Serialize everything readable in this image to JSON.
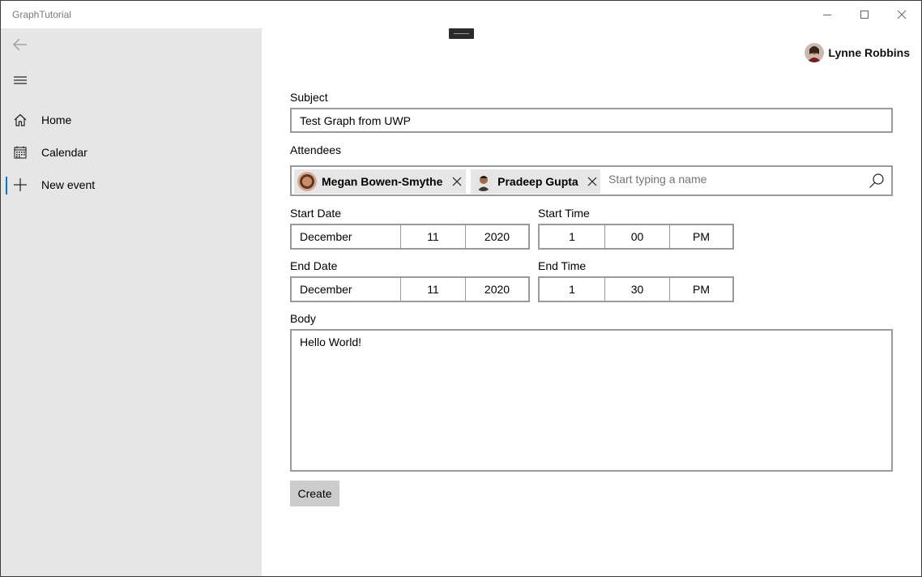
{
  "window": {
    "title": "GraphTutorial"
  },
  "sidebar": {
    "items": [
      {
        "label": "Home",
        "icon": "home-icon"
      },
      {
        "label": "Calendar",
        "icon": "calendar-icon"
      },
      {
        "label": "New event",
        "icon": "plus-icon",
        "selected": true
      }
    ]
  },
  "user": {
    "name": "Lynne Robbins"
  },
  "form": {
    "subject_label": "Subject",
    "subject_value": "Test Graph from UWP",
    "attendees_label": "Attendees",
    "attendees": [
      {
        "name": "Megan Bowen-Smythe"
      },
      {
        "name": "Pradeep Gupta"
      }
    ],
    "attendees_placeholder": "Start typing a name",
    "start_date_label": "Start Date",
    "start_date": {
      "month": "December",
      "day": "11",
      "year": "2020"
    },
    "start_time_label": "Start Time",
    "start_time": {
      "hour": "1",
      "minute": "00",
      "period": "PM"
    },
    "end_date_label": "End Date",
    "end_date": {
      "month": "December",
      "day": "11",
      "year": "2020"
    },
    "end_time_label": "End Time",
    "end_time": {
      "hour": "1",
      "minute": "30",
      "period": "PM"
    },
    "body_label": "Body",
    "body_value": "Hello World!",
    "create_label": "Create"
  },
  "colors": {
    "accent": "#0078d4",
    "sidebar_bg": "#e6e6e6",
    "border": "#9a9a9a",
    "button_bg": "#cccccc"
  }
}
